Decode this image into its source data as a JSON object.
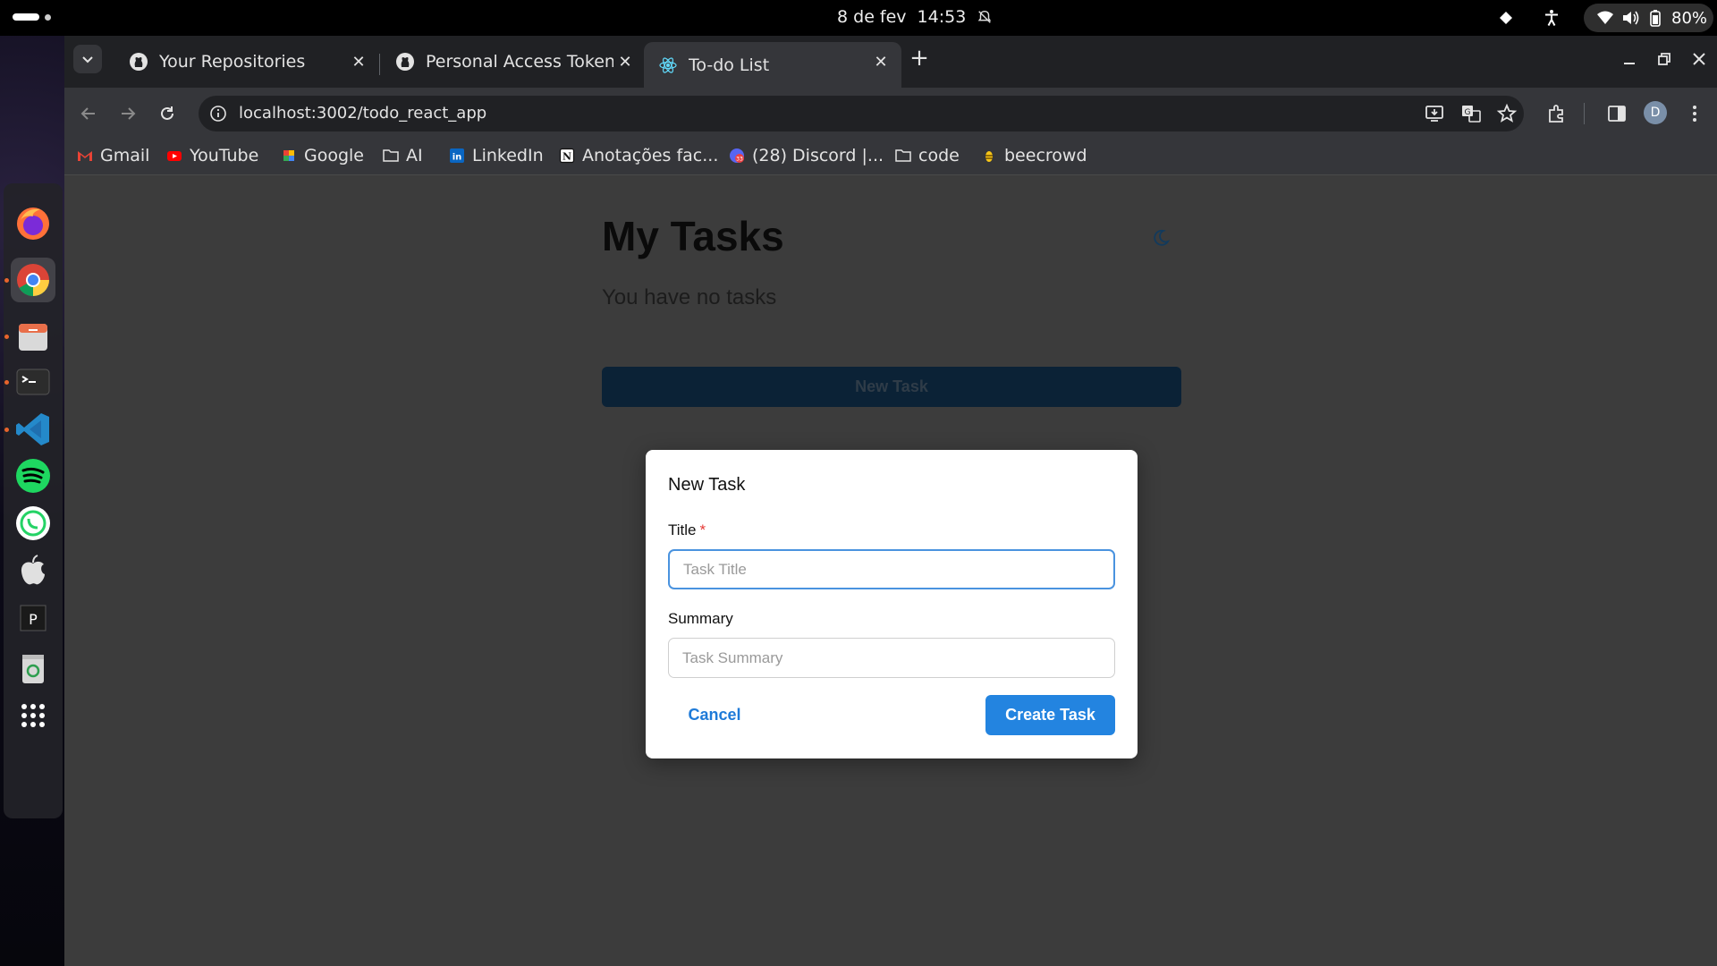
{
  "system_bar": {
    "date": "8 de fev",
    "time": "14:53",
    "battery": "80%"
  },
  "browser": {
    "tabs": [
      {
        "title": "Your Repositories",
        "icon": "github-icon",
        "active": false
      },
      {
        "title": "Personal Access Tokens (",
        "icon": "github-icon",
        "active": false
      },
      {
        "title": "To-do List",
        "icon": "react-icon",
        "active": true
      }
    ],
    "url": "localhost:3002/todo_react_app",
    "profile_initial": "D",
    "bookmarks": [
      {
        "label": "Gmail",
        "icon": "gmail-icon"
      },
      {
        "label": "YouTube",
        "icon": "youtube-icon"
      },
      {
        "label": "Google",
        "icon": "google-icon"
      },
      {
        "label": "AI",
        "icon": "folder-icon"
      },
      {
        "label": "LinkedIn",
        "icon": "linkedin-icon"
      },
      {
        "label": "Anotações fac...",
        "icon": "notion-icon"
      },
      {
        "label": "(28) Discord |...",
        "icon": "discord-icon"
      },
      {
        "label": "code",
        "icon": "folder-icon"
      },
      {
        "label": "beecrowd",
        "icon": "beecrowd-icon"
      }
    ]
  },
  "app": {
    "title": "My Tasks",
    "empty_message": "You have no tasks",
    "new_task_button": "New Task",
    "modal": {
      "title": "New Task",
      "title_label": "Title",
      "title_required_mark": "*",
      "title_value": "",
      "title_placeholder": "Task Title",
      "summary_label": "Summary",
      "summary_value": "",
      "summary_placeholder": "Task Summary",
      "cancel_label": "Cancel",
      "create_label": "Create Task"
    }
  },
  "colors": {
    "accent": "#2384e0",
    "required": "#e53935",
    "overlay_bg": "#3c3c3c"
  }
}
